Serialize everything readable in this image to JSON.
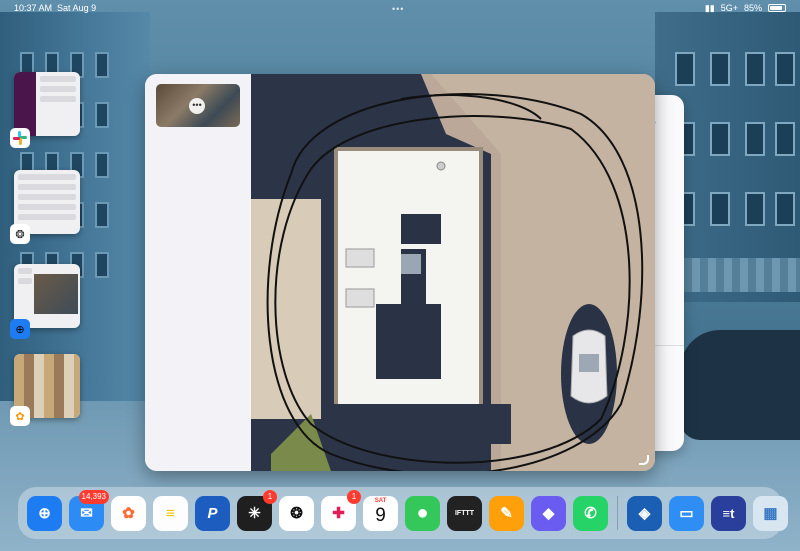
{
  "status_bar": {
    "time": "10:37 AM",
    "date": "Sat Aug 9",
    "network": "5G+",
    "battery": "85%"
  },
  "stage_apps": [
    {
      "name": "Slack",
      "icon": "slack-icon"
    },
    {
      "name": "ChatGPT",
      "icon": "chatgpt-icon"
    },
    {
      "name": "Safari",
      "icon": "safari-icon"
    },
    {
      "name": "Photos",
      "icon": "photos-icon"
    }
  ],
  "main_window": {
    "more_button_glyph": "•••"
  },
  "dock": {
    "apps": [
      {
        "name": "Safari",
        "icon": "safari-icon",
        "color": "#1e7cf2",
        "glyph": "⊕",
        "badge": ""
      },
      {
        "name": "Mail",
        "icon": "mail-icon",
        "color": "#2d8bf5",
        "glyph": "✉",
        "badge": "14,393"
      },
      {
        "name": "Photos",
        "icon": "photos-icon",
        "color": "#ffffff",
        "glyph": "✿",
        "badge": ""
      },
      {
        "name": "Notes",
        "icon": "notes-icon",
        "color": "#fdfdfd",
        "glyph": "≡",
        "badge": ""
      },
      {
        "name": "PayPal",
        "icon": "paypal-icon",
        "color": "#1d5dbf",
        "glyph": "P",
        "badge": ""
      },
      {
        "name": "Perplexity",
        "icon": "perplexity-icon",
        "color": "#1f1f1f",
        "glyph": "✳",
        "badge": "1"
      },
      {
        "name": "ChatGPT",
        "icon": "chatgpt-icon",
        "color": "#ffffff",
        "glyph": "❂",
        "badge": ""
      },
      {
        "name": "Slack",
        "icon": "slack-icon",
        "color": "#ffffff",
        "glyph": "✚",
        "badge": "1"
      },
      {
        "name": "Calendar",
        "icon": "calendar-icon",
        "color": "#ffffff",
        "glyph": "",
        "badge": "",
        "day": "SAT",
        "date": "9"
      },
      {
        "name": "Messages",
        "icon": "messages-icon",
        "color": "#34c759",
        "glyph": "●",
        "badge": ""
      },
      {
        "name": "IFTTT",
        "icon": "ifttt-icon",
        "color": "#222222",
        "glyph": "IFTTT",
        "badge": ""
      },
      {
        "name": "Pages",
        "icon": "pages-icon",
        "color": "#ff9f0a",
        "glyph": "✎",
        "badge": ""
      },
      {
        "name": "Shortcuts",
        "icon": "shortcuts-icon",
        "color": "#6a5cf0",
        "glyph": "◆",
        "badge": ""
      },
      {
        "name": "WhatsApp",
        "icon": "whatsapp-icon",
        "color": "#25d366",
        "glyph": "✆",
        "badge": ""
      },
      {
        "name": "Chase",
        "icon": "chase-icon",
        "color": "#1a5fb4",
        "glyph": "◈",
        "badge": ""
      },
      {
        "name": "Files",
        "icon": "files-icon",
        "color": "#2f8ef4",
        "glyph": "▭",
        "badge": ""
      },
      {
        "name": "E*Trade",
        "icon": "etrade-icon",
        "color": "#2a3f9c",
        "glyph": "≡t",
        "badge": ""
      },
      {
        "name": "App Library",
        "icon": "app-library-icon",
        "color": "#d8e6f2",
        "glyph": "▦",
        "badge": ""
      }
    ]
  }
}
